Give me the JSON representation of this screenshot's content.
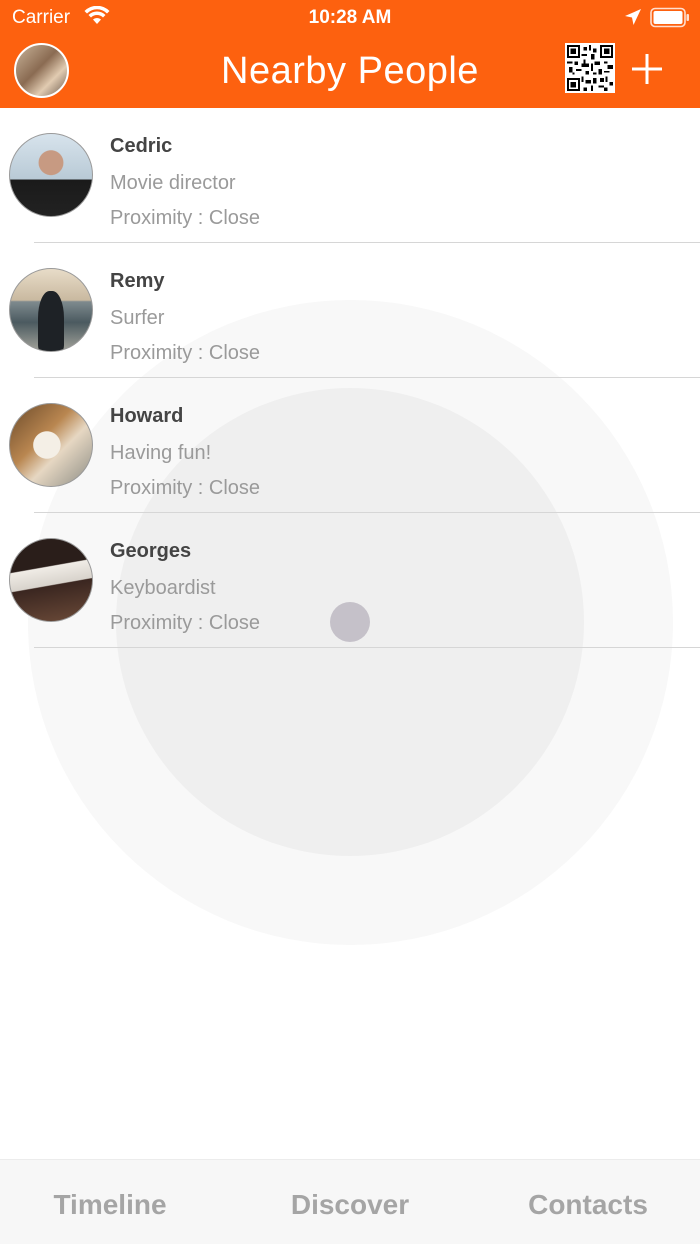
{
  "status_bar": {
    "carrier": "Carrier",
    "time": "10:28 AM"
  },
  "nav": {
    "title": "Nearby People",
    "left_icon": "profile-avatar",
    "right_icons": [
      "qr-code-icon",
      "plus-icon"
    ]
  },
  "people": [
    {
      "name": "Cedric",
      "subtitle": "Movie director",
      "proximity": "Proximity : Close"
    },
    {
      "name": "Remy",
      "subtitle": "Surfer",
      "proximity": "Proximity : Close"
    },
    {
      "name": "Howard",
      "subtitle": "Having fun!",
      "proximity": "Proximity : Close"
    },
    {
      "name": "Georges",
      "subtitle": "Keyboardist",
      "proximity": "Proximity : Close"
    }
  ],
  "tabs": [
    {
      "label": "Timeline"
    },
    {
      "label": "Discover"
    },
    {
      "label": "Contacts"
    }
  ],
  "colors": {
    "accent": "#fd610f",
    "tab_inactive": "#a5a5a5",
    "radar_outer": "#f8f8f8",
    "radar_inner": "#efefef",
    "radar_dot": "#c5c1c9"
  }
}
